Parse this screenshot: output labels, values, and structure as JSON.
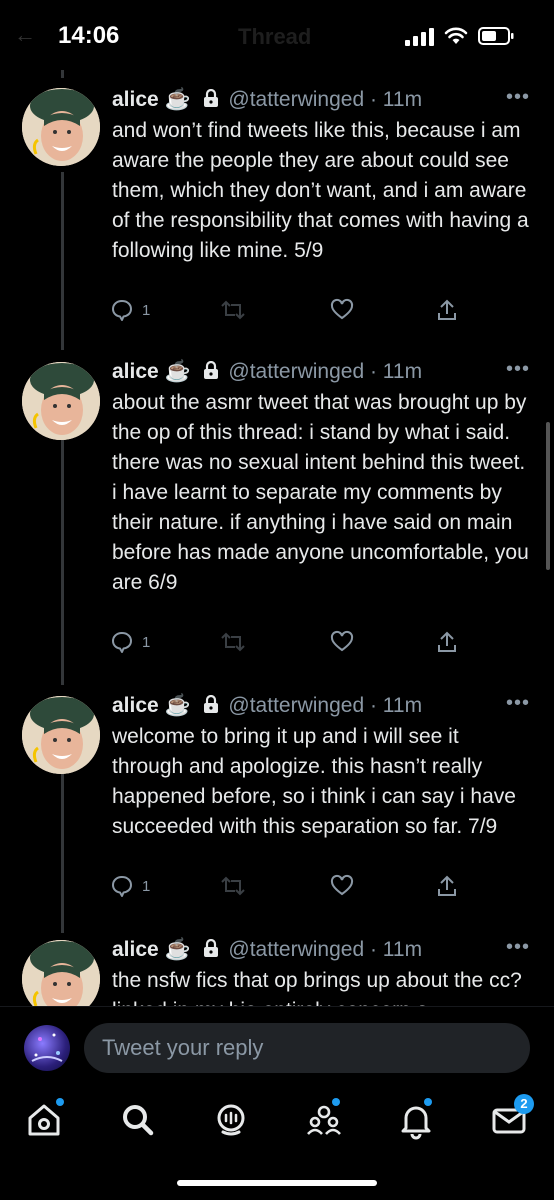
{
  "status": {
    "time": "14:06"
  },
  "header": {
    "title": "Thread"
  },
  "tweets": [
    {
      "name": "alice",
      "emoji": "☕",
      "handle": "@tatterwinged",
      "time": "· 11m",
      "text": "and won’t find tweets like this, because i am aware the people they are about could see them, which they don’t want, and i am aware of the responsibility that comes with having a following like mine. 5/9",
      "replies": "1"
    },
    {
      "name": "alice",
      "emoji": "☕",
      "handle": "@tatterwinged",
      "time": "· 11m",
      "text": "about the asmr tweet that was brought up by the op of this thread: i stand by what i said. there was no sexual intent behind this tweet. i have learnt to separate my comments by their nature. if anything i have said on main before has made anyone uncomfortable, you are 6/9",
      "replies": "1"
    },
    {
      "name": "alice",
      "emoji": "☕",
      "handle": "@tatterwinged",
      "time": "· 11m",
      "text": "welcome to bring it up and i will see it through and apologize. this hasn’t really happened before, so i think i can say i have succeeded with this separation so far. 7/9",
      "replies": "1"
    },
    {
      "name": "alice",
      "emoji": "☕",
      "handle": "@tatterwinged",
      "time": "· 11m",
      "text": "the nsfw fics that op brings up about the cc? linked in my bio entirely concern a",
      "replies": ""
    }
  ],
  "reply": {
    "placeholder": "Tweet your reply"
  },
  "tabbar": {
    "messages_badge": "2"
  }
}
